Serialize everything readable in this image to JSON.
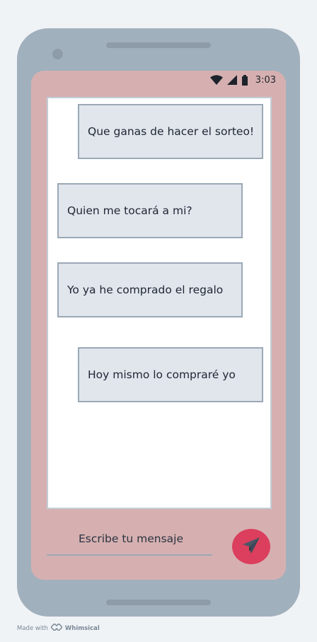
{
  "status_bar": {
    "time": "3:03",
    "icons": [
      "wifi-icon",
      "cellular-signal-icon",
      "battery-icon"
    ]
  },
  "chat": {
    "messages": [
      {
        "text": "Que ganas de hacer el sorteo!",
        "side": "right"
      },
      {
        "text": "Quien me tocará a mi?",
        "side": "left"
      },
      {
        "text": "Yo ya he comprado el regalo",
        "side": "left"
      },
      {
        "text": "Hoy mismo lo compraré yo",
        "side": "right"
      }
    ]
  },
  "composer": {
    "placeholder": "Escribe tu mensaje",
    "send_icon": "paper-plane-icon"
  },
  "footer": {
    "made_with": "Made with",
    "brand": "Whimsical"
  },
  "colors": {
    "page_background": "#f0f3f6",
    "phone_frame": "#a1b0bd",
    "screen_background": "#d6b0b1",
    "bubble_fill": "#e1e5ec",
    "bubble_border": "#9aa9b6",
    "send_button": "#db3f5d"
  }
}
